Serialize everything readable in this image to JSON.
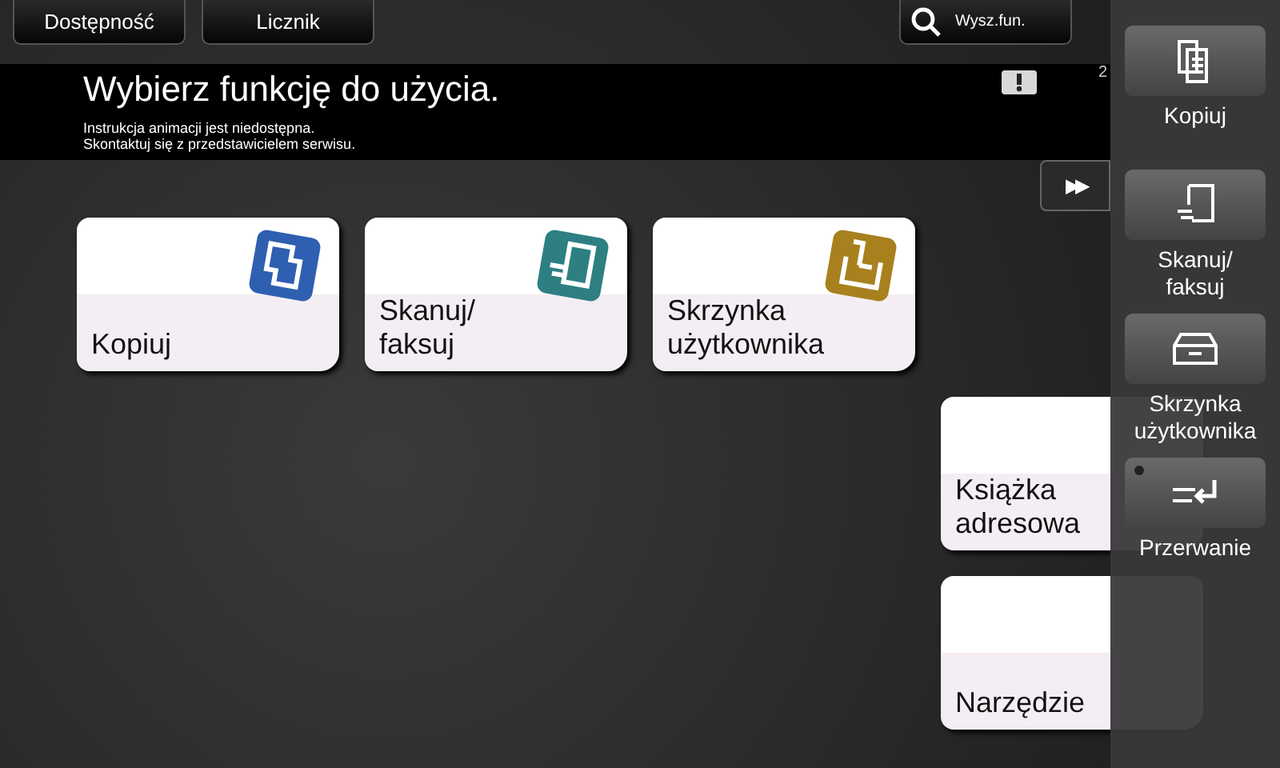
{
  "top_bar": {
    "buttons": [
      {
        "label": "Dostępność"
      },
      {
        "label": "Licznik"
      }
    ],
    "search_button": {
      "label": "Wysz.fun."
    }
  },
  "banner": {
    "title": "Wybierz funkcję do użycia.",
    "message_lines": [
      "Instrukcja animacji jest niedostępna.",
      "Skontaktuj się z przedstawicielem serwisu."
    ],
    "side_text": "2"
  },
  "forward_button": {
    "label": "▶▶"
  },
  "function_tiles": [
    {
      "kind": "copy",
      "label": "Kopiuj"
    },
    {
      "kind": "scan",
      "label": "Skanuj/\nfaksuj"
    },
    {
      "kind": "box",
      "label": "Skrzynka\nużytkownika"
    },
    {
      "kind": "address",
      "label": "Książka\nadresowa"
    },
    {
      "kind": "tool",
      "label": "Narzędzie"
    }
  ],
  "side_panel": {
    "items": [
      {
        "kind": "copy",
        "label": "Kopiuj"
      },
      {
        "kind": "scan",
        "label": "Skanuj/\nfaksuj"
      },
      {
        "kind": "box",
        "label": "Skrzynka\nużytkownika"
      },
      {
        "kind": "interrupt",
        "label": "Przerwanie"
      }
    ]
  }
}
